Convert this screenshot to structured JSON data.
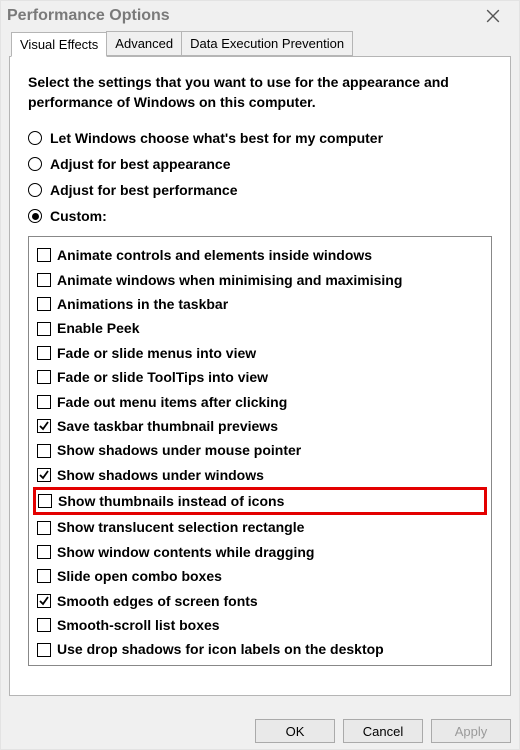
{
  "window": {
    "title": "Performance Options"
  },
  "tabs": {
    "visual_effects": "Visual Effects",
    "advanced": "Advanced",
    "dep": "Data Execution Prevention"
  },
  "description": "Select the settings that you want to use for the appearance and performance of Windows on this computer.",
  "radios": {
    "auto": "Let Windows choose what's best for my computer",
    "best_appearance": "Adjust for best appearance",
    "best_performance": "Adjust for best performance",
    "custom": "Custom:"
  },
  "options": [
    {
      "label": "Animate controls and elements inside windows",
      "checked": false,
      "highlight": false
    },
    {
      "label": "Animate windows when minimising and maximising",
      "checked": false,
      "highlight": false
    },
    {
      "label": "Animations in the taskbar",
      "checked": false,
      "highlight": false
    },
    {
      "label": "Enable Peek",
      "checked": false,
      "highlight": false
    },
    {
      "label": "Fade or slide menus into view",
      "checked": false,
      "highlight": false
    },
    {
      "label": "Fade or slide ToolTips into view",
      "checked": false,
      "highlight": false
    },
    {
      "label": "Fade out menu items after clicking",
      "checked": false,
      "highlight": false
    },
    {
      "label": "Save taskbar thumbnail previews",
      "checked": true,
      "highlight": false
    },
    {
      "label": "Show shadows under mouse pointer",
      "checked": false,
      "highlight": false
    },
    {
      "label": "Show shadows under windows",
      "checked": true,
      "highlight": false
    },
    {
      "label": "Show thumbnails instead of icons",
      "checked": false,
      "highlight": true
    },
    {
      "label": "Show translucent selection rectangle",
      "checked": false,
      "highlight": false
    },
    {
      "label": "Show window contents while dragging",
      "checked": false,
      "highlight": false
    },
    {
      "label": "Slide open combo boxes",
      "checked": false,
      "highlight": false
    },
    {
      "label": "Smooth edges of screen fonts",
      "checked": true,
      "highlight": false
    },
    {
      "label": "Smooth-scroll list boxes",
      "checked": false,
      "highlight": false
    },
    {
      "label": "Use drop shadows for icon labels on the desktop",
      "checked": false,
      "highlight": false
    }
  ],
  "buttons": {
    "ok": "OK",
    "cancel": "Cancel",
    "apply": "Apply"
  }
}
